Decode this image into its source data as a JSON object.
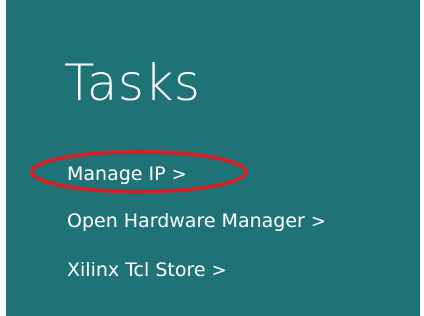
{
  "panel": {
    "title": "Tasks",
    "background": "#1f7276"
  },
  "tasks": [
    {
      "label": "Manage IP",
      "chevron": ">"
    },
    {
      "label": "Open Hardware Manager",
      "chevron": ">"
    },
    {
      "label": "Xilinx Tcl Store",
      "chevron": ">"
    }
  ],
  "annotation": {
    "color": "#e01b22",
    "target": "Manage IP"
  }
}
